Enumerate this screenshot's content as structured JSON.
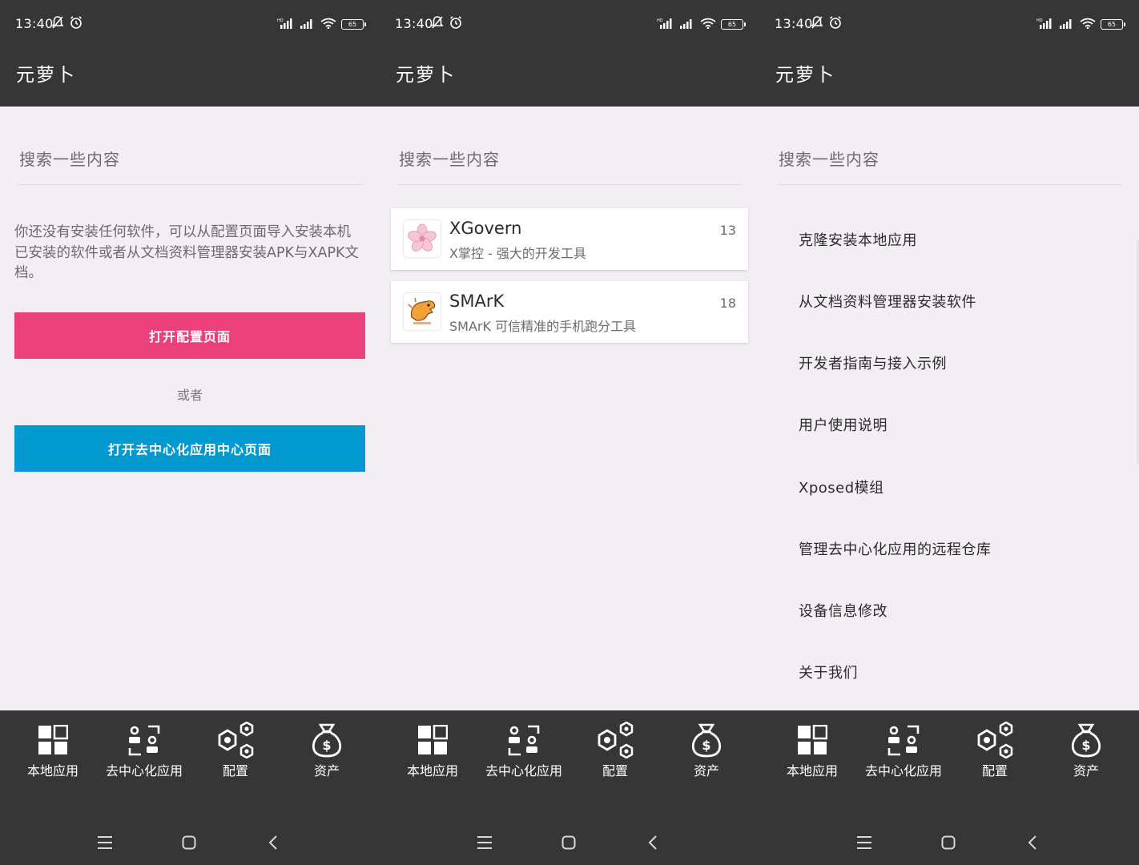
{
  "status": {
    "time": "13:40",
    "battery": "65"
  },
  "app": {
    "title": "元萝卜"
  },
  "search": {
    "placeholder": "搜索一些内容"
  },
  "local": {
    "empty_message": "你还没有安装任何软件，可以从配置页面导入安装本机已安装的软件或者从文档资料管理器安装APK与XAPK文档。",
    "open_config_button": "打开配置页面",
    "or_text": "或者",
    "open_decentralized_button": "打开去中心化应用中心页面"
  },
  "apps": [
    {
      "name": "XGovern",
      "description": "X掌控 - 强大的开发工具",
      "count": "13",
      "icon": "sakura-flower-icon"
    },
    {
      "name": "SMArK",
      "description": "SMArK 可信精准的手机跑分工具",
      "count": "18",
      "icon": "orange-dinosaur-icon"
    }
  ],
  "config_menu": [
    "克隆安装本地应用",
    "从文档资料管理器安装软件",
    "开发者指南与接入示例",
    "用户使用说明",
    "Xposed模组",
    "管理去中心化应用的远程仓库",
    "设备信息修改",
    "关于我们"
  ],
  "bottom_nav": [
    "本地应用",
    "去中心化应用",
    "配置",
    "资产"
  ],
  "colors": {
    "bar": "#363636",
    "background": "#f3eef4",
    "pink": "#eb407a",
    "blue": "#0199cf"
  }
}
